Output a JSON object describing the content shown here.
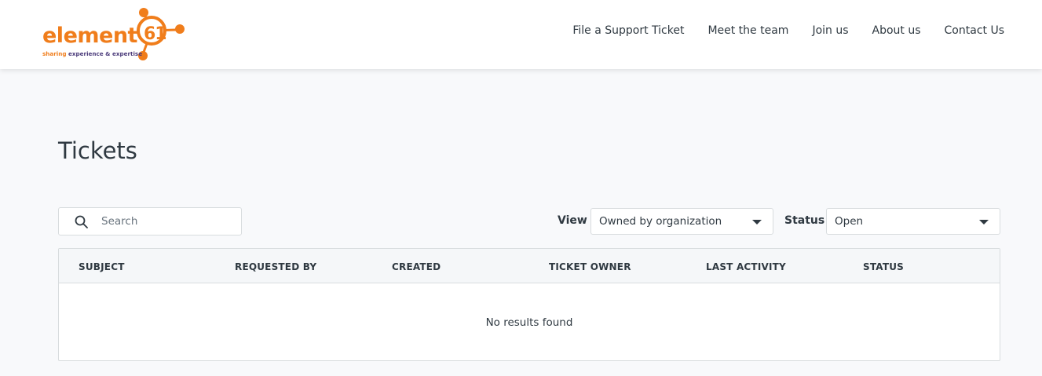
{
  "brand": {
    "wordmark": "element",
    "number": "61",
    "tagline_accent": "sharing",
    "tagline_rest": " experience & expertise",
    "color": "#f07d1b",
    "secondary_color": "#4a3a7a"
  },
  "nav": {
    "items": [
      {
        "label": "File a Support Ticket"
      },
      {
        "label": "Meet the team"
      },
      {
        "label": "Join us"
      },
      {
        "label": "About us"
      },
      {
        "label": "Contact Us"
      }
    ]
  },
  "page": {
    "title": "Tickets"
  },
  "search": {
    "icon": "search-icon",
    "placeholder": "Search",
    "value": ""
  },
  "filters": {
    "view": {
      "label": "View",
      "selected": "Owned by organization"
    },
    "status": {
      "label": "Status",
      "selected": "Open"
    }
  },
  "table": {
    "columns": [
      "SUBJECT",
      "REQUESTED BY",
      "CREATED",
      "TICKET OWNER",
      "LAST ACTIVITY",
      "STATUS"
    ],
    "rows": [],
    "empty_message": "No results found"
  }
}
